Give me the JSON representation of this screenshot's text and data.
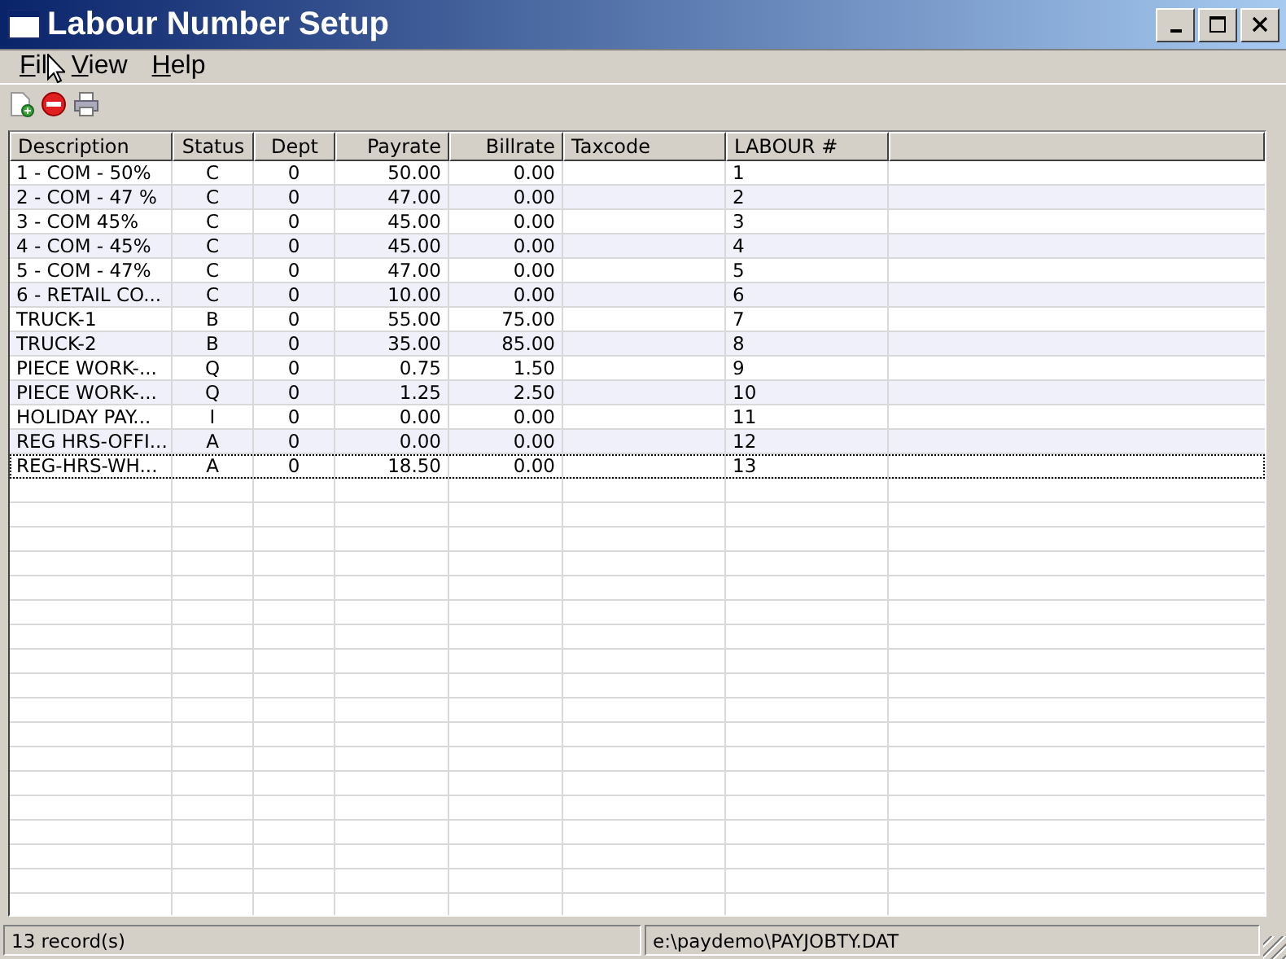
{
  "window": {
    "title": "Labour Number Setup"
  },
  "menu": [
    {
      "label": "Fil"
    },
    {
      "label": "View"
    },
    {
      "label": "Help"
    }
  ],
  "table": {
    "columns": [
      {
        "label": "Description"
      },
      {
        "label": "Status"
      },
      {
        "label": "Dept"
      },
      {
        "label": "Payrate"
      },
      {
        "label": "Billrate"
      },
      {
        "label": "Taxcode"
      },
      {
        "label": "LABOUR #"
      }
    ],
    "rows": [
      {
        "cells": [
          "1 - COM - 50%",
          "C",
          "0",
          "50.00",
          "0.00",
          "",
          "1"
        ],
        "focused": false
      },
      {
        "cells": [
          "2 - COM - 47 %",
          "C",
          "0",
          "47.00",
          "0.00",
          "",
          "2"
        ],
        "focused": false
      },
      {
        "cells": [
          "3 - COM 45%",
          "C",
          "0",
          "45.00",
          "0.00",
          "",
          "3"
        ],
        "focused": false
      },
      {
        "cells": [
          "4 - COM - 45%",
          "C",
          "0",
          "45.00",
          "0.00",
          "",
          "4"
        ],
        "focused": false
      },
      {
        "cells": [
          "5 - COM - 47%",
          "C",
          "0",
          "47.00",
          "0.00",
          "",
          "5"
        ],
        "focused": false
      },
      {
        "cells": [
          "6 - RETAIL CO...",
          "C",
          "0",
          "10.00",
          "0.00",
          "",
          "6"
        ],
        "focused": false
      },
      {
        "cells": [
          "TRUCK-1",
          "B",
          "0",
          "55.00",
          "75.00",
          "",
          "7"
        ],
        "focused": false
      },
      {
        "cells": [
          "TRUCK-2",
          "B",
          "0",
          "35.00",
          "85.00",
          "",
          "8"
        ],
        "focused": false
      },
      {
        "cells": [
          "PIECE WORK-...",
          "Q",
          "0",
          "0.75",
          "1.50",
          "",
          "9"
        ],
        "focused": false
      },
      {
        "cells": [
          "PIECE WORK-...",
          "Q",
          "0",
          "1.25",
          "2.50",
          "",
          "10"
        ],
        "focused": false
      },
      {
        "cells": [
          "HOLIDAY PAY...",
          "I",
          "0",
          "0.00",
          "0.00",
          "",
          "11"
        ],
        "focused": false
      },
      {
        "cells": [
          "REG HRS-OFFI...",
          "A",
          "0",
          "0.00",
          "0.00",
          "",
          "12"
        ],
        "focused": false
      },
      {
        "cells": [
          "REG-HRS-WH...",
          "A",
          "0",
          "18.50",
          "0.00",
          "",
          "13"
        ],
        "focused": true
      }
    ]
  },
  "status_bar": [
    "13 record(s)",
    "e:\\paydemo\\PAYJOBTY.DAT"
  ]
}
